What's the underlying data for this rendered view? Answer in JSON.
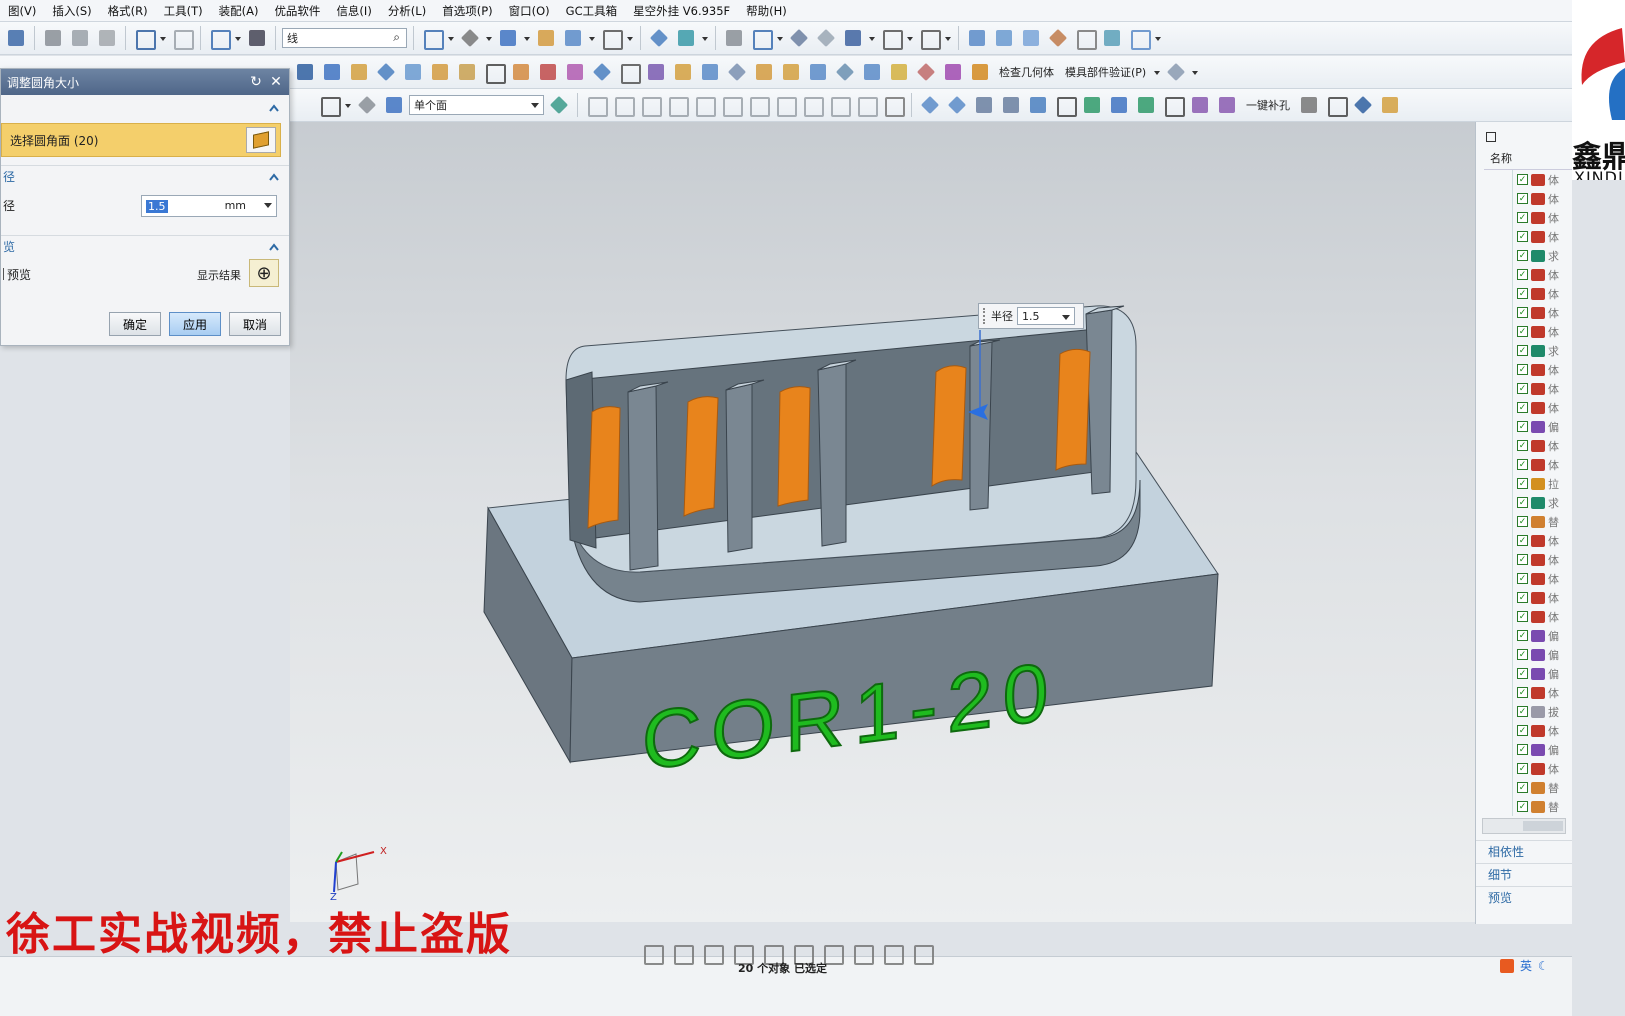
{
  "menu": [
    "图(V)",
    "插入(S)",
    "格式(R)",
    "工具(T)",
    "装配(A)",
    "优品软件",
    "信息(I)",
    "分析(L)",
    "首选项(P)",
    "窗口(O)",
    "GC工具箱",
    "星空外挂 V6.935F",
    "帮助(H)"
  ],
  "toolbar": {
    "search_value": "线",
    "filter_value": "单个面",
    "check_geometry": "检查几何体",
    "mold_verify": "模具部件验证(P)",
    "one_key_fill": "一键补孔"
  },
  "dialog": {
    "title": "调整圆角大小",
    "select_face_label": "选择圆角面 (20)",
    "radius_section": "径",
    "radius_label": "径",
    "radius_value": "1.5",
    "radius_unit": "mm",
    "preview_section": "览",
    "preview_label": "预览",
    "show_result_label": "显示结果",
    "ok_label": "确定",
    "apply_label": "应用",
    "cancel_label": "取消"
  },
  "viewport": {
    "radius_popup_label": "半径",
    "radius_popup_value": "1.5",
    "part_text": "COR1-20",
    "axis_x": "X",
    "axis_z": "Z"
  },
  "right_panel": {
    "header_name": "名称",
    "tree_items": [
      "体",
      "体",
      "体",
      "体",
      "求",
      "体",
      "体",
      "体",
      "体",
      "求",
      "体",
      "体",
      "体",
      "偏",
      "体",
      "体",
      "拉",
      "求",
      "替",
      "体",
      "体",
      "体",
      "体",
      "体",
      "偏",
      "偏",
      "偏",
      "体",
      "拔",
      "体",
      "偏",
      "体",
      "替",
      "替"
    ],
    "sections": [
      "相依性",
      "细节",
      "预览"
    ]
  },
  "logo": {
    "text_cn": "鑫鼎",
    "text_en": "XINDI"
  },
  "status": {
    "text": "20 个对象 已选定",
    "ime": "英"
  },
  "watermark": "徐工实战视频，禁止盗版",
  "colors": {
    "fillet_face": "#e8841c",
    "text_green": "#1fbb1f",
    "part_top": "#c3d2dd",
    "part_side": "#6d7b86",
    "accent_blue": "#2e6aa5"
  }
}
